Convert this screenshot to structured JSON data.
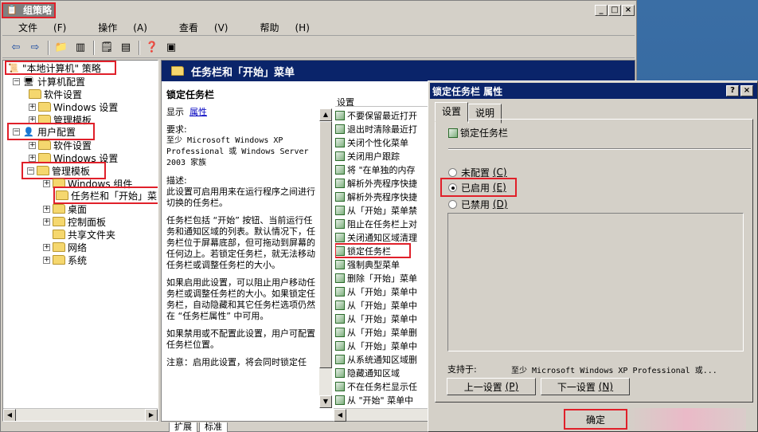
{
  "window": {
    "title": "组策略"
  },
  "menu": [
    {
      "label": "文件",
      "key": "(F)"
    },
    {
      "label": "操作",
      "key": "(A)"
    },
    {
      "label": "查看",
      "key": "(V)"
    },
    {
      "label": "帮助",
      "key": "(H)"
    }
  ],
  "tree": {
    "root": "\"本地计算机\" 策略",
    "computer_config": "计算机配置",
    "software1": "软件设置",
    "windows1": "Windows 设置",
    "admin1": "管理模板",
    "user_config": "用户配置",
    "software2": "软件设置",
    "windows2": "Windows 设置",
    "admin2": "管理模板",
    "win_components": "Windows 组件",
    "taskbar": "任务栏和「开始」菜",
    "desktop": "桌面",
    "control_panel": "控制面板",
    "shared_folders": "共享文件夹",
    "network": "网络",
    "system": "系统"
  },
  "right": {
    "header": "任务栏和「开始」菜单",
    "setting_title": "锁定任务栏",
    "show_label": "显示",
    "properties_link": "属性",
    "requirements_label": "要求:",
    "requirements": "至少 Microsoft Windows XP Professional 或 Windows Server 2003 家族",
    "description_label": "描述:",
    "para1": "此设置可启用用来在运行程序之间进行切换的任务栏。",
    "para2": "任务栏包括 “开始” 按钮、当前运行任务和通知区域的列表。默认情况下，任务栏位于屏幕底部，但可拖动到屏幕的任何边上。若锁定任务栏，就无法移动任务栏或调整任务栏的大小。",
    "para3": "如果启用此设置，可以阻止用户移动任务栏或调整任务栏的大小。如果锁定任务栏，自动隐藏和其它任务栏选项仍然在 “任务栏属性” 中可用。",
    "para4": "如果禁用或不配置此设置，用户可配置任务栏位置。",
    "para5": "注意：启用此设置，将会同时锁定任",
    "list_header": "设置",
    "items": [
      "不要保留最近打开",
      "退出时清除最近打",
      "关闭个性化菜单",
      "关闭用户跟踪",
      "将 \"在单独的内存",
      "解析外壳程序快捷",
      "解析外壳程序快捷",
      "从「开始」菜单禁",
      "阻止在任务栏上对",
      "关闭通知区域清理",
      "锁定任务栏",
      "强制典型菜单",
      "删除「开始」菜单",
      "从「开始」菜单中",
      "从「开始」菜单中",
      "从「开始」菜单中",
      "从「开始」菜单删",
      "从「开始」菜单中",
      "从系统通知区域删",
      "隐藏通知区域",
      "不在任务栏显示任",
      "从 \"开始\" 菜单中"
    ],
    "tabs": [
      "扩展",
      "标准"
    ]
  },
  "dialog": {
    "title": "锁定任务栏 属性",
    "tab_settings": "设置",
    "tab_explain": "说明",
    "setting_name": "锁定任务栏",
    "opt_not_configured": "未配置",
    "opt_not_configured_key": "(C)",
    "opt_enabled": "已启用",
    "opt_enabled_key": "(E)",
    "opt_disabled": "已禁用",
    "opt_disabled_key": "(D)",
    "supported_label": "支持于:",
    "supported_value": "至少 Microsoft Windows XP Professional 或...",
    "prev_button": "上一设置",
    "prev_key": "(P)",
    "next_button": "下一设置",
    "next_key": "(N)",
    "ok_button": "确定",
    "selected": "enabled"
  }
}
